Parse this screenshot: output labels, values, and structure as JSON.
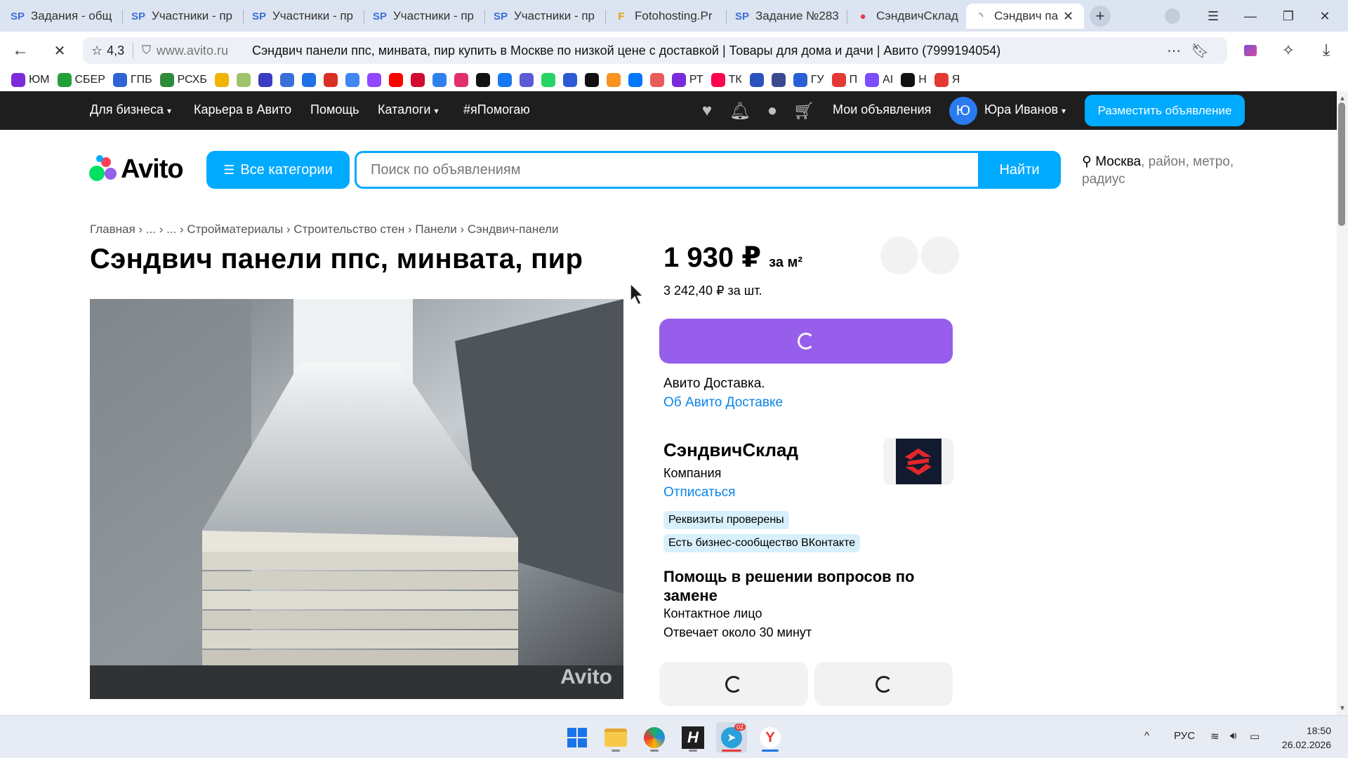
{
  "browser": {
    "tabs": [
      {
        "label": "Задания - общ",
        "icon": "SP"
      },
      {
        "label": "Участники - пр",
        "icon": "SP"
      },
      {
        "label": "Участники - пр",
        "icon": "SP"
      },
      {
        "label": "Участники - пр",
        "icon": "SP"
      },
      {
        "label": "Участники - пр",
        "icon": "SP"
      },
      {
        "label": "Fotohosting.Pr",
        "icon": "F"
      },
      {
        "label": "Задание №283",
        "icon": "SP"
      },
      {
        "label": "СэндвичСклад",
        "icon": "●"
      },
      {
        "label": "Сэндвич пан",
        "icon": "◝"
      }
    ],
    "rating": "4,3",
    "host": "www.avito.ru",
    "page_title": "Сэндвич панели ппс, минвата, пир купить в Москве по низкой цене с доставкой | Товары для дома и дачи | Авито (7999194054)",
    "bookmarks": [
      {
        "label": "ЮМ",
        "color": "#7b2bd9"
      },
      {
        "label": "СБЕР",
        "color": "#21a038"
      },
      {
        "label": "ГПБ",
        "color": "#2f64d6"
      },
      {
        "label": "РСХБ",
        "color": "#2e8b3a"
      },
      {
        "label": "",
        "color": "#f0b400"
      },
      {
        "label": "",
        "color": "#9fc36a"
      },
      {
        "label": "",
        "color": "#3b3bc4"
      },
      {
        "label": "",
        "color": "#3a6fd8"
      },
      {
        "label": "",
        "color": "#1e6fe8"
      },
      {
        "label": "",
        "color": "#d93025"
      },
      {
        "label": "",
        "color": "#4285f4"
      },
      {
        "label": "",
        "color": "#9146ff"
      },
      {
        "label": "",
        "color": "#ff0000"
      },
      {
        "label": "",
        "color": "#d10b2f"
      },
      {
        "label": "",
        "color": "#2f80ed"
      },
      {
        "label": "",
        "color": "#e1306c"
      },
      {
        "label": "",
        "color": "#111111"
      },
      {
        "label": "",
        "color": "#1877f2"
      },
      {
        "label": "",
        "color": "#5b5bd6"
      },
      {
        "label": "",
        "color": "#25d366"
      },
      {
        "label": "",
        "color": "#2d5bd6"
      },
      {
        "label": "",
        "color": "#111111"
      },
      {
        "label": "",
        "color": "#f7931e"
      },
      {
        "label": "",
        "color": "#0077ff"
      },
      {
        "label": "",
        "color": "#e85c5c"
      },
      {
        "label": "РТ",
        "color": "#7b2bd9"
      },
      {
        "label": "ТК",
        "color": "#ff0050"
      },
      {
        "label": "",
        "color": "#2a52be"
      },
      {
        "label": "",
        "color": "#3a4a8c"
      },
      {
        "label": "ГУ",
        "color": "#2b5fd6"
      },
      {
        "label": "П",
        "color": "#e53935"
      },
      {
        "label": "AI",
        "color": "#7c4dff"
      },
      {
        "label": "Н",
        "color": "#111111"
      },
      {
        "label": "Я",
        "color": "#e53935"
      }
    ]
  },
  "avito": {
    "top_nav": {
      "business": "Для бизнеса",
      "career": "Карьера в Авито",
      "help": "Помощь",
      "catalogs": "Каталоги",
      "ya_help": "#яПомогаю",
      "my_ads": "Мои объявления",
      "avatar_letter": "Ю",
      "user_name": "Юра Иванов",
      "post_ad": "Разместить объявление"
    },
    "logo_text": "Avito",
    "all_categories": "Все категории",
    "search_placeholder": "Поиск по объявлениям",
    "search_button": "Найти",
    "location": {
      "city": "Москва",
      "rest": ", район, метро, радиус"
    },
    "breadcrumb": "Главная › ... › ... › Стройматериалы › Строительство стен › Панели › Сэндвич-панели",
    "title": "Сэндвич панели ппс, минвата, пир",
    "watermark": "Avito",
    "price": "1 930 ₽",
    "price_unit": "за м²",
    "price_alt": "3 242,40 ₽ за шт.",
    "delivery_title": "Авито Доставка.",
    "delivery_link": "Об Авито Доставке",
    "seller": {
      "name": "СэндвичСклад",
      "type": "Компания",
      "unsubscribe": "Отписаться",
      "badges": [
        "Реквизиты проверены",
        "Есть бизнес-сообщество ВКонтакте"
      ]
    },
    "help": {
      "title": "Помощь в решении вопросов по замене",
      "contact": "Контактное лицо",
      "response": "Отвечает около 30 минут"
    }
  },
  "taskbar": {
    "lang": "РУС",
    "time": "18:50",
    "date": "26.02.2026",
    "telegram_badge": "02"
  },
  "colors": {
    "accent": "#00aaff",
    "buy": "#965eeb",
    "link": "#0a85e8",
    "header": "#1e1e1e"
  }
}
